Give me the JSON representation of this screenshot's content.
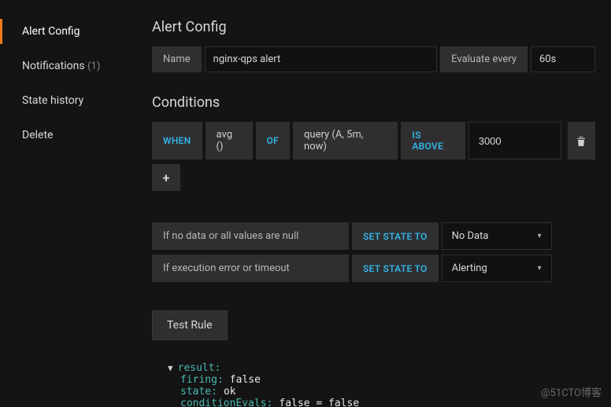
{
  "sidebar": {
    "items": [
      {
        "label": "Alert Config",
        "active": true
      },
      {
        "label": "Notifications",
        "count": "(1)"
      },
      {
        "label": "State history"
      },
      {
        "label": "Delete"
      }
    ]
  },
  "header": {
    "title": "Alert Config",
    "nameLabel": "Name",
    "nameValue": "nginx-qps alert",
    "evalLabel": "Evaluate every",
    "evalValue": "60s"
  },
  "conditions": {
    "title": "Conditions",
    "cond": {
      "when": "WHEN",
      "agg": "avg ()",
      "of": "OF",
      "query": "query (A, 5m, now)",
      "op": "IS ABOVE",
      "threshold": "3000"
    }
  },
  "states": {
    "nodata": {
      "label": "If no data or all values are null",
      "kw": "SET STATE TO",
      "value": "No Data"
    },
    "error": {
      "label": "If execution error or timeout",
      "kw": "SET STATE TO",
      "value": "Alerting"
    }
  },
  "testRule": {
    "label": "Test Rule"
  },
  "result": {
    "rootKey": "result:",
    "firingKey": "firing:",
    "firingVal": "false",
    "stateKey": "state:",
    "stateVal": "ok",
    "condKey": "conditionEvals:",
    "condVal": "false = false"
  },
  "watermark": "@51CTO博客"
}
